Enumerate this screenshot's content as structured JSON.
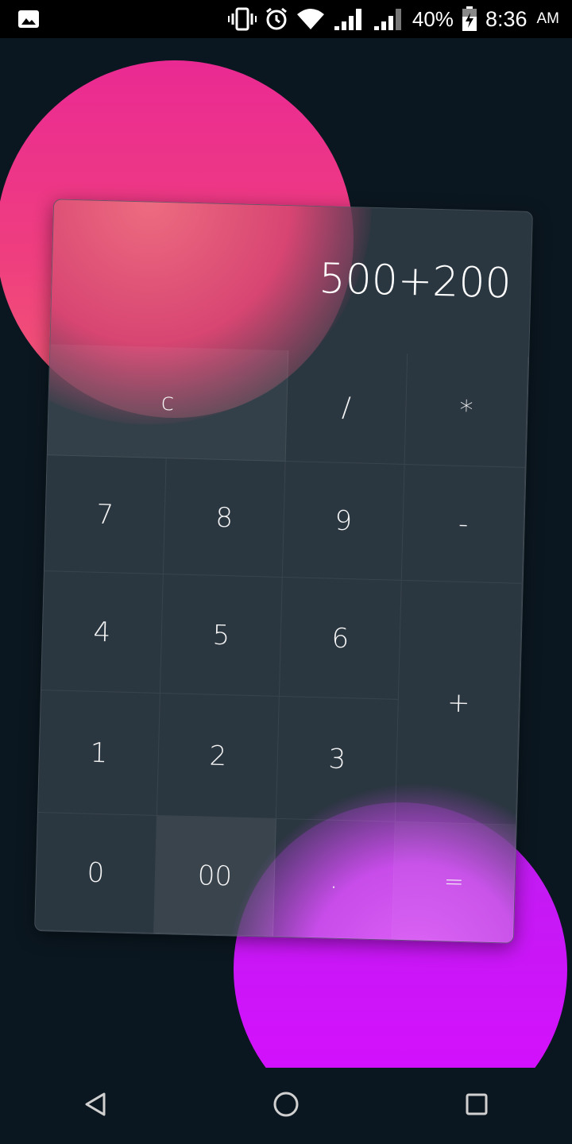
{
  "status_bar": {
    "battery": "40%",
    "time": "8:36",
    "ampm": "AM",
    "icons": [
      "image-icon",
      "vibrate-icon",
      "alarm-icon",
      "wifi-icon",
      "signal-icon",
      "signal-icon-2",
      "battery-charging-icon"
    ]
  },
  "calculator": {
    "display": "500+200",
    "keys": {
      "clear": "c",
      "divide": "/",
      "multiply": "*",
      "seven": "7",
      "eight": "8",
      "nine": "9",
      "minus": "-",
      "four": "4",
      "five": "5",
      "six": "6",
      "plus": "+",
      "one": "1",
      "two": "2",
      "three": "3",
      "zero": "0",
      "double_zero": "00",
      "decimal": ".",
      "equals": "="
    }
  },
  "nav": {
    "icons": [
      "back-icon",
      "home-icon",
      "recents-icon"
    ]
  },
  "colors": {
    "background": "#0b1720",
    "pink_blob": "#ea2a93",
    "purple_blob": "#d90dff"
  }
}
